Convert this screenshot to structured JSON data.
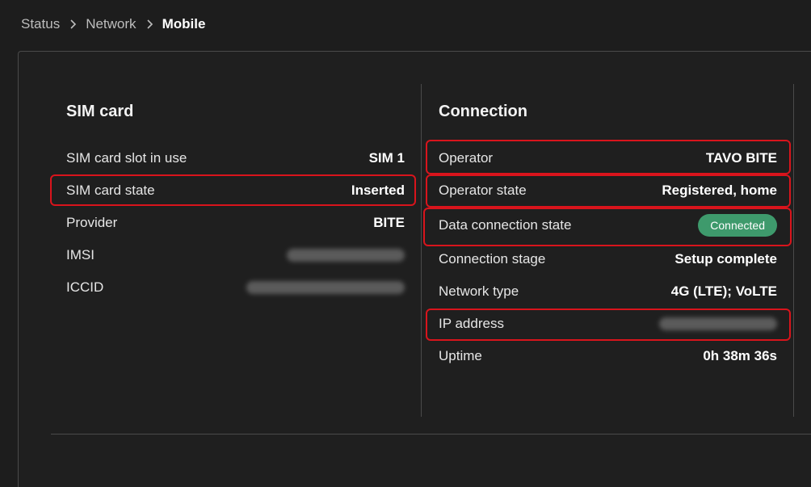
{
  "breadcrumb": {
    "items": [
      "Status",
      "Network"
    ],
    "current": "Mobile"
  },
  "sim_card": {
    "title": "SIM card",
    "rows": [
      {
        "label": "SIM card slot in use",
        "value": "SIM 1"
      },
      {
        "label": "SIM card state",
        "value": "Inserted"
      },
      {
        "label": "Provider",
        "value": "BITE"
      },
      {
        "label": "IMSI",
        "value": ""
      },
      {
        "label": "ICCID",
        "value": ""
      }
    ]
  },
  "connection": {
    "title": "Connection",
    "rows": [
      {
        "label": "Operator",
        "value": "TAVO BITE"
      },
      {
        "label": "Operator state",
        "value": "Registered, home"
      },
      {
        "label": "Data connection state",
        "value": "Connected"
      },
      {
        "label": "Connection stage",
        "value": "Setup complete"
      },
      {
        "label": "Network type",
        "value": "4G (LTE); VoLTE"
      },
      {
        "label": "IP address",
        "value": ""
      },
      {
        "label": "Uptime",
        "value": "0h 38m 36s"
      }
    ]
  },
  "colors": {
    "highlight": "#d9141c",
    "connected_badge": "#3e9a6c",
    "background": "#1d1d1d"
  },
  "icons": {
    "breadcrumb_separator": "chevron-right-icon"
  }
}
